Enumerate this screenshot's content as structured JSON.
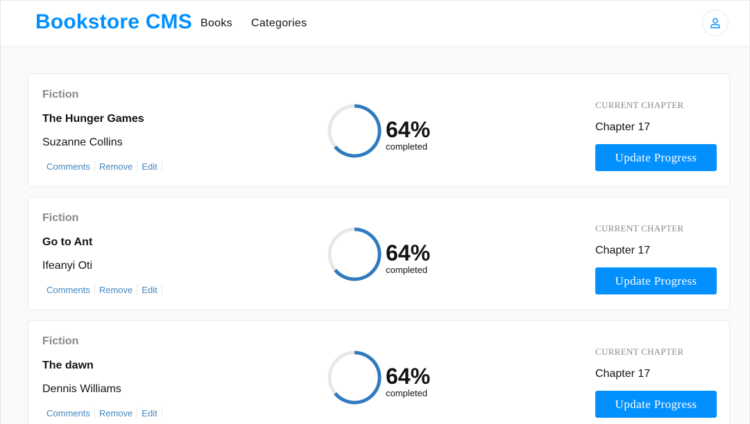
{
  "header": {
    "brand": "Bookstore CMS",
    "nav": [
      "Books",
      "Categories"
    ],
    "user_icon": "user-icon"
  },
  "colors": {
    "accent": "#0290ff",
    "ring_progress": "#307bbe",
    "ring_track": "#e8e8e8",
    "link": "#4386bf"
  },
  "books": [
    {
      "genre": "Fiction",
      "title": "The Hunger Games",
      "author": "Suzanne Collins",
      "actions": [
        "Comments",
        "Remove",
        "Edit"
      ],
      "progress_percent": 64,
      "percent_label": "64%",
      "completed_label": "completed",
      "current_chapter_label": "CURRENT CHAPTER",
      "current_chapter": "Chapter 17",
      "update_label": "Update Progress"
    },
    {
      "genre": "Fiction",
      "title": "Go to Ant",
      "author": "Ifeanyi Oti",
      "actions": [
        "Comments",
        "Remove",
        "Edit"
      ],
      "progress_percent": 64,
      "percent_label": "64%",
      "completed_label": "completed",
      "current_chapter_label": "CURRENT CHAPTER",
      "current_chapter": "Chapter 17",
      "update_label": "Update Progress"
    },
    {
      "genre": "Fiction",
      "title": "The dawn",
      "author": "Dennis Williams",
      "actions": [
        "Comments",
        "Remove",
        "Edit"
      ],
      "progress_percent": 64,
      "percent_label": "64%",
      "completed_label": "completed",
      "current_chapter_label": "CURRENT CHAPTER",
      "current_chapter": "Chapter 17",
      "update_label": "Update Progress"
    }
  ]
}
